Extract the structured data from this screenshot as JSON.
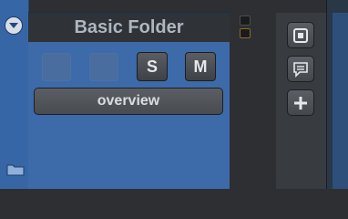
{
  "track": {
    "name": "Basic Folder",
    "solo_label": "S",
    "mute_label": "M",
    "overview_label": "overview"
  },
  "icons": {
    "collapse": "collapse-arrow-icon",
    "folder": "folder-icon",
    "plugins": "square-icon",
    "comment": "comment-icon",
    "add": "plus-icon"
  },
  "colors": {
    "track_blue": "#3d6aa8",
    "title_bar": "#2f3236",
    "button_gray": "#5b5f65"
  }
}
